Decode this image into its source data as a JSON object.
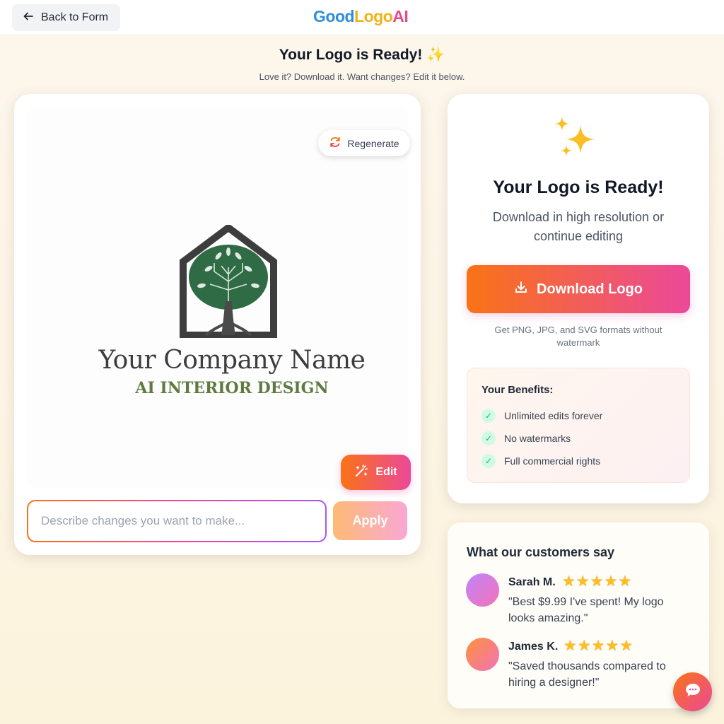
{
  "header": {
    "back_label": "Back to Form",
    "brand_part1": "Good",
    "brand_part2": "Logo",
    "brand_part3": "AI"
  },
  "hero": {
    "title": "Your Logo is Ready! ✨",
    "subtitle": "Love it? Download it. Want changes? Edit it below."
  },
  "preview": {
    "regenerate_label": "Regenerate",
    "logo_company": "Your Company Name",
    "logo_tagline": "AI INTERIOR DESIGN",
    "edit_label": "Edit",
    "input_placeholder": "Describe changes you want to make...",
    "input_value": "",
    "apply_label": "Apply"
  },
  "download_panel": {
    "title": "Your Logo is Ready!",
    "subtitle": "Download in high resolution or continue editing",
    "download_label": "Download Logo",
    "formats_note": "Get PNG, JPG, and SVG formats without watermark",
    "benefits_title": "Your Benefits:",
    "benefits": [
      "Unlimited edits forever",
      "No watermarks",
      "Full commercial rights"
    ]
  },
  "reviews": {
    "title": "What our customers say",
    "items": [
      {
        "name": "Sarah M.",
        "rating": 5,
        "quote": "\"Best $9.99 I've spent! My logo looks amazing.\""
      },
      {
        "name": "James K.",
        "rating": 5,
        "quote": "\"Saved thousands compared to hiring a designer!\""
      }
    ]
  },
  "colors": {
    "accent_start": "#f97316",
    "accent_end": "#ec4899",
    "logo_green": "#2f6b45",
    "logo_gray": "#3d3d3d",
    "tagline_green": "#5e7a3f"
  },
  "icons": {
    "back": "arrow-left-icon",
    "regenerate": "refresh-icon",
    "edit": "magic-wand-icon",
    "sparkle": "sparkles-icon",
    "download": "download-icon",
    "check": "check-icon",
    "chat": "chat-bubble-icon"
  }
}
